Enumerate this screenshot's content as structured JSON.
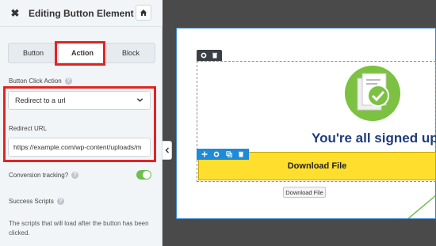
{
  "header": {
    "title": "Editing Button Element",
    "close_icon": "close-icon",
    "home_icon": "home-icon"
  },
  "tabs": [
    {
      "label": "Button",
      "active": false
    },
    {
      "label": "Action",
      "active": true
    },
    {
      "label": "Block",
      "active": false
    }
  ],
  "click_action": {
    "label": "Button Click Action",
    "value": "Redirect to a url"
  },
  "redirect": {
    "label": "Redirect URL",
    "value": "https://example.com/wp-content/uploads/m"
  },
  "conversion": {
    "label": "Conversion tracking?",
    "enabled": true
  },
  "scripts": {
    "label": "Success Scripts",
    "description": "The scripts that will load after the button has been clicked."
  },
  "preview": {
    "heading": "You're all signed up!",
    "button_label": "Download File",
    "tooltip": "Download File"
  },
  "colors": {
    "accent_blue": "#1e8ad8",
    "highlight_red": "#e02424",
    "button_yellow": "#ffde2e",
    "toggle_green": "#6fbf4e",
    "heading_navy": "#1f3c7a"
  }
}
